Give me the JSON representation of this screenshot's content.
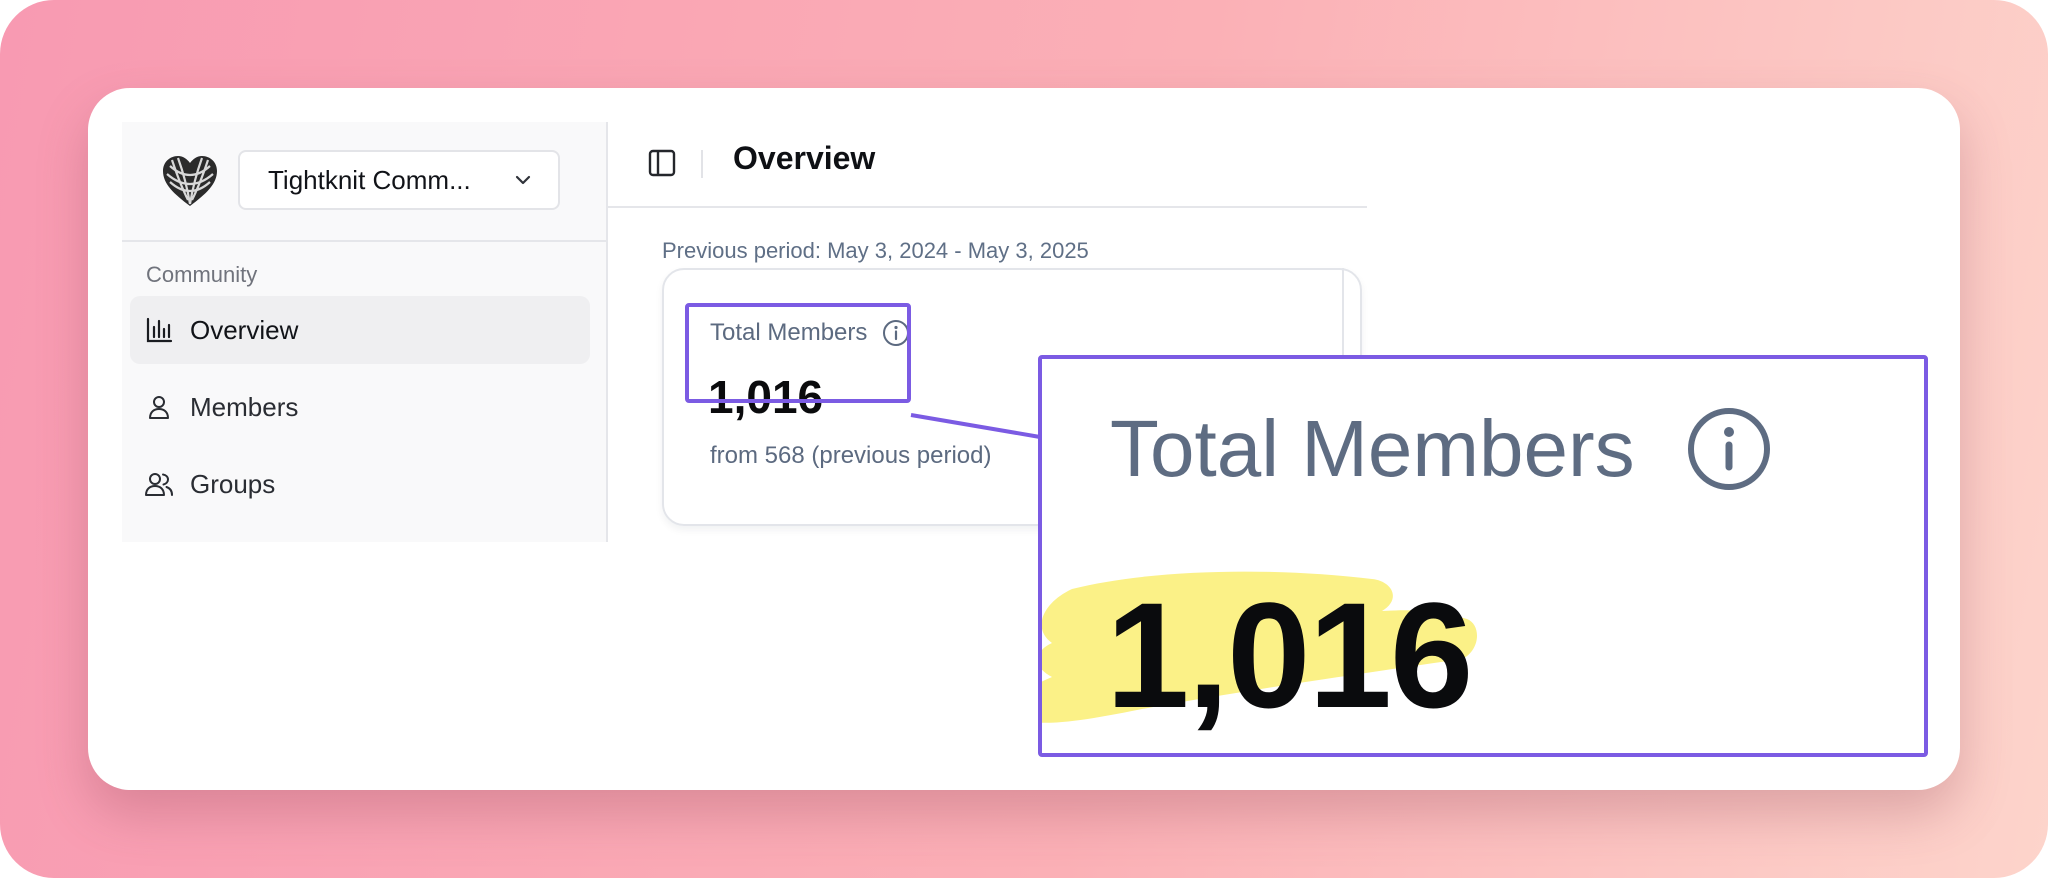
{
  "sidebar": {
    "community_name": "Tightknit Comm...",
    "section_label": "Community",
    "items": [
      {
        "label": "Overview",
        "icon": "bar-chart-icon",
        "active": true
      },
      {
        "label": "Members",
        "icon": "user-icon",
        "active": false
      },
      {
        "label": "Groups",
        "icon": "users-icon",
        "active": false
      }
    ]
  },
  "header": {
    "title": "Overview"
  },
  "main": {
    "previous_period": "Previous period: May 3, 2024 - May 3, 2025",
    "stat": {
      "label": "Total Members",
      "value": "1,016",
      "comparison": "from 568 (previous period)"
    }
  },
  "zoom": {
    "label": "Total Members",
    "value": "1,016"
  },
  "colors": {
    "accent_outline": "#7b5be3",
    "highlighter": "#fbf187",
    "background_start": "#f89ab2",
    "background_end": "#fdd4cb"
  }
}
